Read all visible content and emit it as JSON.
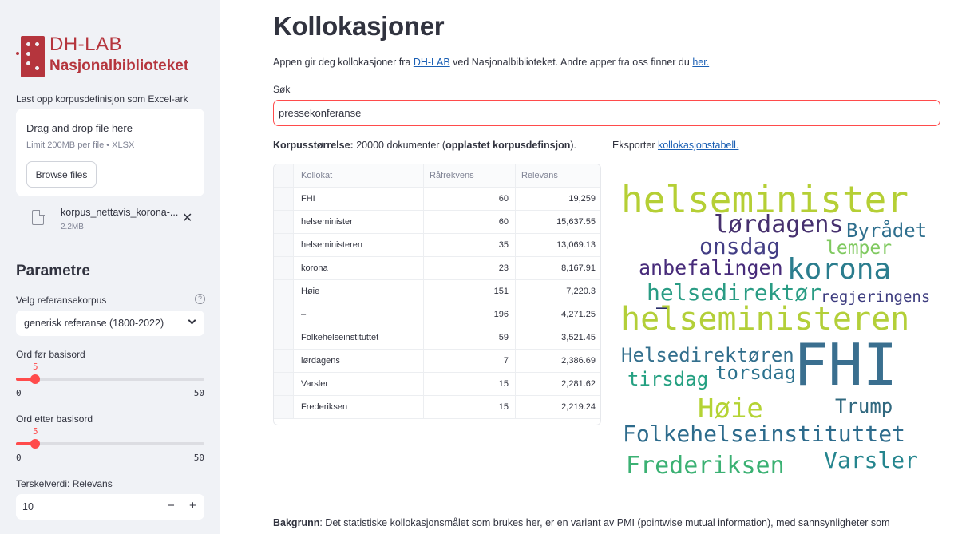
{
  "sidebar": {
    "logo": {
      "line1": "DH-LAB",
      "line2": "Nasjonalbiblioteket"
    },
    "upload_label": "Last opp korpusdefinisjon som Excel-ark",
    "uploader": {
      "title": "Drag and drop file here",
      "limit": "Limit 200MB per file • XLSX",
      "browse_label": "Browse files"
    },
    "file": {
      "name": "korpus_nettavis_korona-...",
      "size": "2.2MB",
      "close_icon": "close-icon"
    },
    "params_title": "Parametre",
    "ref_corpus": {
      "label": "Velg referansekorpus",
      "value": "generisk referanse (1800-2022)"
    },
    "before": {
      "label": "Ord før basisord",
      "value": "5",
      "value_num": 5,
      "min": "0",
      "max": "50",
      "max_num": 50
    },
    "after": {
      "label": "Ord etter basisord",
      "value": "5",
      "value_num": 5,
      "min": "0",
      "max": "50",
      "max_num": 50
    },
    "threshold": {
      "label": "Terskelverdi: Relevans",
      "value": "10",
      "minus": "−",
      "plus": "+"
    }
  },
  "main": {
    "title": "Kollokasjoner",
    "intro": {
      "pre": "Appen gir deg kollokasjoner fra ",
      "link1": "DH-LAB",
      "mid": " ved Nasjonalbiblioteket. Andre apper fra oss finner du ",
      "link2": "her."
    },
    "search": {
      "label": "Søk",
      "value": "pressekonferanse"
    },
    "corpus": {
      "label": "Korpusstørrelse:",
      "count": " 20000 dokumenter (",
      "source": "opplastet korpusdefinsjon",
      "end": ")."
    },
    "export": {
      "text": "Eksporter ",
      "link": "kollokasjonstabell."
    },
    "table": {
      "headers": [
        "Kollokat",
        "Råfrekvens",
        "Relevans"
      ],
      "rows": [
        [
          "FHI",
          "60",
          "19,259"
        ],
        [
          "helseminister",
          "60",
          "15,637.55"
        ],
        [
          "helseministeren",
          "35",
          "13,069.13"
        ],
        [
          "korona",
          "23",
          "8,167.91"
        ],
        [
          "Høie",
          "151",
          "7,220.3"
        ],
        [
          "–",
          "196",
          "4,271.25"
        ],
        [
          "Folkehelseinstituttet",
          "59",
          "3,521.45"
        ],
        [
          "lørdagens",
          "7",
          "2,386.69"
        ],
        [
          "Varsler",
          "15",
          "2,281.62"
        ],
        [
          "Frederiksen",
          "15",
          "2,219.24"
        ]
      ]
    },
    "wordcloud": [
      {
        "text": "helseminister",
        "color": "#b5cf35"
      },
      {
        "text": "lørdagens",
        "color": "#46306e"
      },
      {
        "text": "Byrådet",
        "color": "#2f6f8e"
      },
      {
        "text": "onsdag",
        "color": "#433e85"
      },
      {
        "text": "lemper",
        "color": "#7fc95f"
      },
      {
        "text": "anbefalingen",
        "color": "#472b7a"
      },
      {
        "text": "korona",
        "color": "#2b7d8e"
      },
      {
        "text": "helsedirektør",
        "color": "#2a9c84"
      },
      {
        "text": "–",
        "color": "#2a2f6b"
      },
      {
        "text": "regjeringens",
        "color": "#3d3c7f"
      },
      {
        "text": "helseministeren",
        "color": "#b3cf39"
      },
      {
        "text": "Helsedirektøren",
        "color": "#336f8d"
      },
      {
        "text": "FHI",
        "color": "#3a6f8f"
      },
      {
        "text": "tirsdag",
        "color": "#24a081"
      },
      {
        "text": "torsdag",
        "color": "#2c728e"
      },
      {
        "text": "Høie",
        "color": "#b4d334"
      },
      {
        "text": "Trump",
        "color": "#30687f"
      },
      {
        "text": "Folkehelseinstituttet",
        "color": "#2d6b8c"
      },
      {
        "text": "Frederiksen",
        "color": "#3bb173"
      },
      {
        "text": "Varsler",
        "color": "#25858e"
      }
    ],
    "bakgrunn": {
      "label": "Bakgrunn",
      "text": ": Det statistiske kollokasjonsmålet som brukes her, er en variant av PMI (pointwise mutual information), med sannsynligheter som"
    }
  }
}
